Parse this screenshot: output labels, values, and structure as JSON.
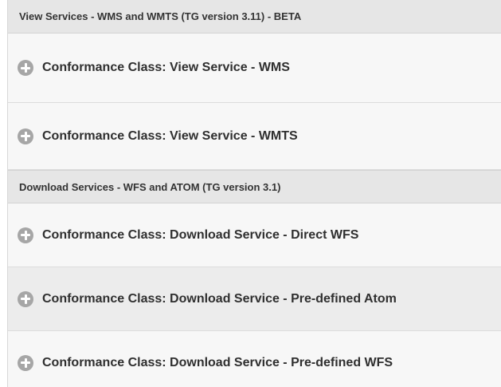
{
  "sections": [
    {
      "title": "View Services - WMS and WMTS (TG version 3.11) - BETA",
      "items": [
        {
          "label": "Conformance Class: View Service - WMS",
          "icon": "plus-circle-icon"
        },
        {
          "label": "Conformance Class: View Service - WMTS",
          "icon": "plus-circle-icon"
        }
      ]
    },
    {
      "title": "Download Services - WFS and ATOM (TG version 3.1)",
      "items": [
        {
          "label": "Conformance Class: Download Service - Direct WFS",
          "icon": "plus-circle-icon"
        },
        {
          "label": "Conformance Class: Download Service - Pre-defined Atom",
          "icon": "plus-circle-icon"
        },
        {
          "label": "Conformance Class: Download Service - Pre-defined WFS",
          "icon": "plus-circle-icon"
        }
      ]
    }
  ]
}
